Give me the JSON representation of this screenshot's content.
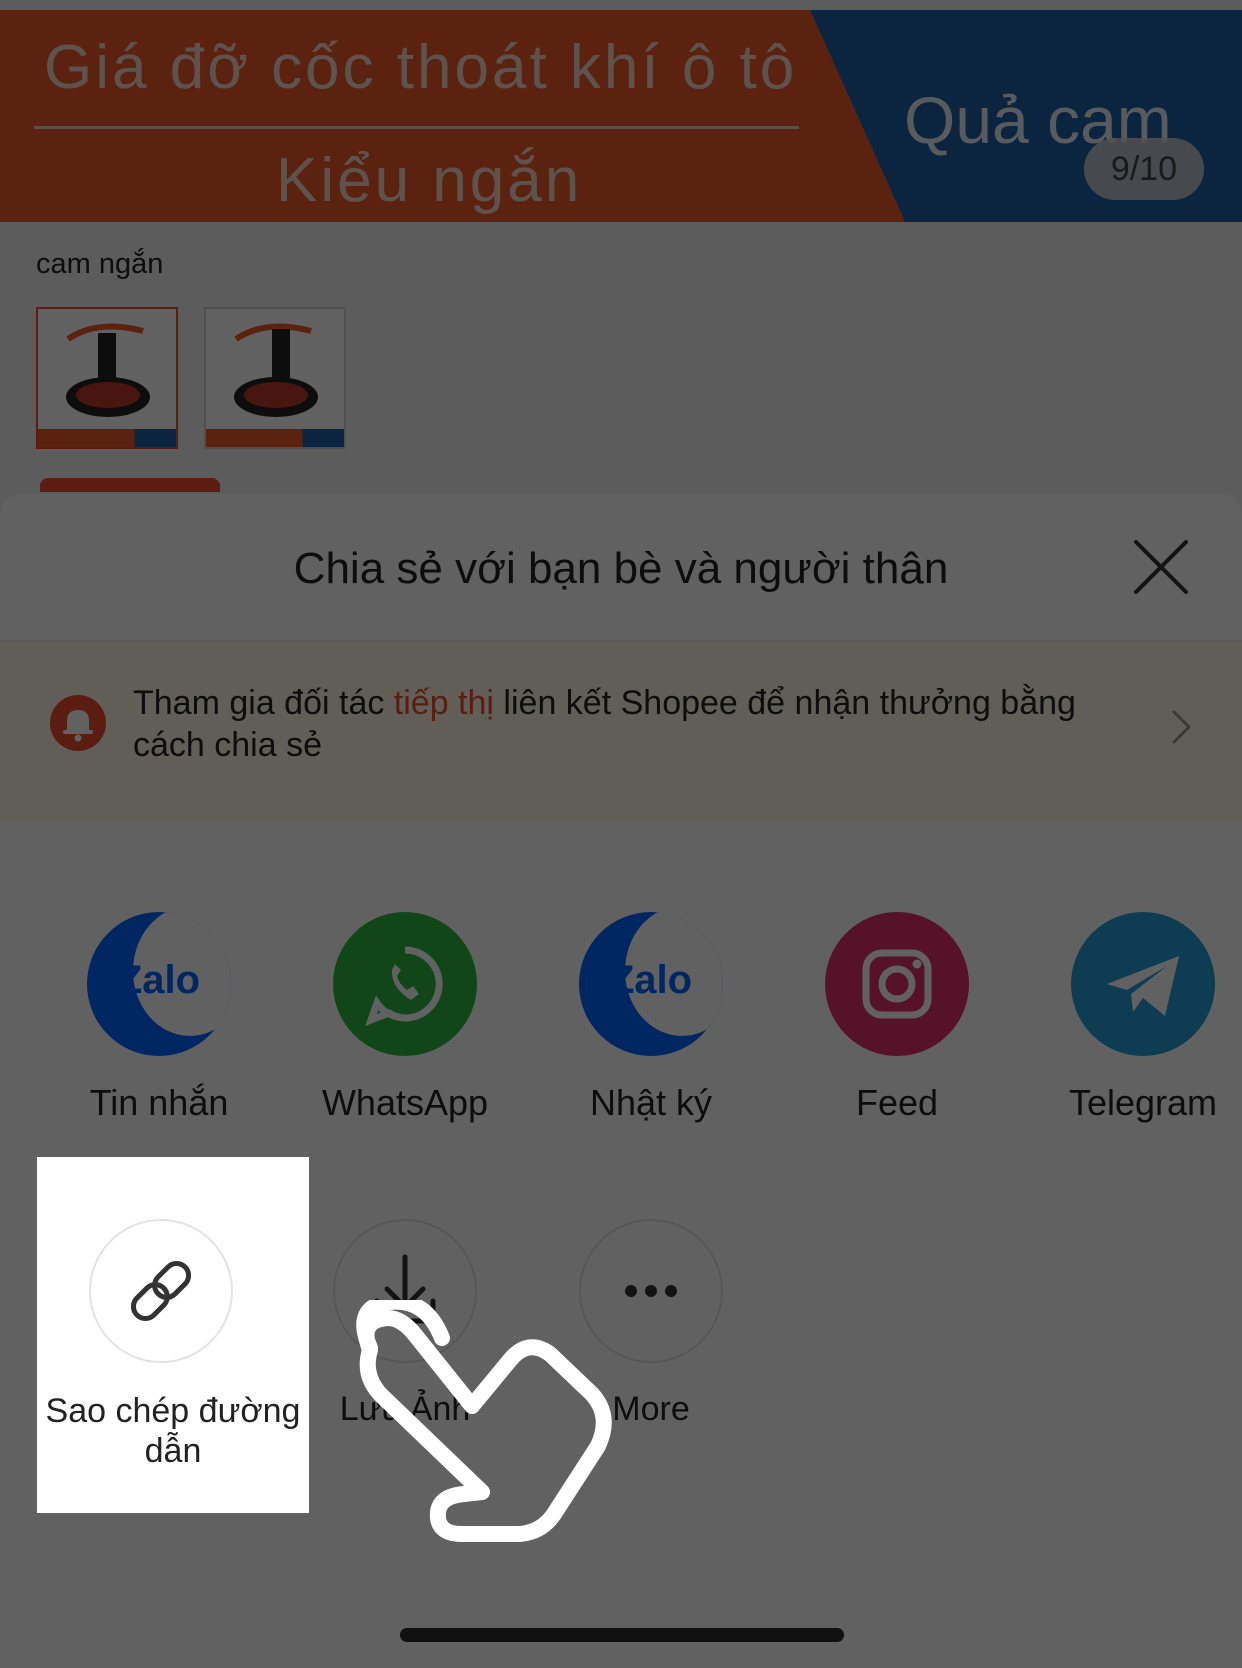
{
  "product": {
    "banner_line1": "Giá đỡ cốc thoát khí ô tô",
    "banner_line2": "Kiểu ngắn",
    "banner_right": "Quả cam",
    "image_counter": "9/10",
    "variant_label": "cam ngắn"
  },
  "share_sheet": {
    "title": "Chia sẻ với bạn bè và người thân",
    "promo_before": "Tham gia đối tác ",
    "promo_highlight": "tiếp thị",
    "promo_after": " liên kết Shopee để nhận thưởng bằng cách chia sẻ",
    "apps": [
      {
        "label": "Tin nhắn",
        "icon": "zalo-icon",
        "icon_text": "Zalo"
      },
      {
        "label": "WhatsApp",
        "icon": "whatsapp-icon"
      },
      {
        "label": "Nhật ký",
        "icon": "zalo-icon",
        "icon_text": "Zalo"
      },
      {
        "label": "Feed",
        "icon": "instagram-icon"
      },
      {
        "label": "Telegram",
        "icon": "telegram-icon"
      }
    ],
    "actions": [
      {
        "label": "Sao chép đường dẫn",
        "icon": "link-icon"
      },
      {
        "label": "Lưu Ảnh",
        "icon": "download-icon"
      },
      {
        "label": "More",
        "icon": "more-icon"
      }
    ]
  },
  "colors": {
    "shopee_orange": "#ee4d2d",
    "zalo_blue": "#0068ff",
    "whatsapp_green": "#2bb741",
    "instagram_pink": "#e1306c",
    "telegram_blue": "#229ed9"
  }
}
